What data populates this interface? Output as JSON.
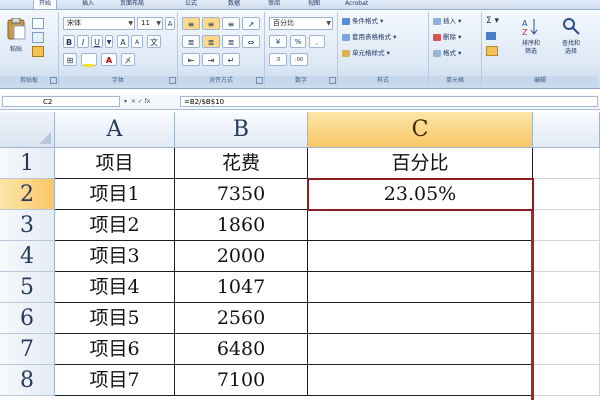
{
  "ribbon": {
    "tabs": [
      "开始",
      "插入",
      "页面布局",
      "公式",
      "数据",
      "审阅",
      "视图",
      "Acrobat"
    ],
    "groups": {
      "clipboard": "剪贴板",
      "font": "字体",
      "alignment": "对齐方式",
      "number": "数字",
      "styles": "样式",
      "cells": "单元格",
      "editing": "编辑"
    },
    "paste_label": "粘贴",
    "font_name": "宋体",
    "font_size": "11",
    "number_format": "百分比",
    "styles_items": [
      "条件格式",
      "套用表格格式",
      "单元格样式"
    ],
    "cells_items": [
      "插入",
      "删除",
      "格式"
    ],
    "editing_sort": "排序和\n筛选",
    "editing_find": "查找和\n选择"
  },
  "formula_bar": {
    "name_box": "C2",
    "formula": "=B2/$B$10"
  },
  "sheet": {
    "columns": [
      "A",
      "B",
      "C"
    ],
    "rows": [
      "1",
      "2",
      "3",
      "4",
      "5",
      "6",
      "7",
      "8"
    ],
    "cells": [
      [
        "项目",
        "花费",
        "百分比"
      ],
      [
        "项目1",
        "7350",
        "23.05%"
      ],
      [
        "项目2",
        "1860",
        ""
      ],
      [
        "项目3",
        "2000",
        ""
      ],
      [
        "项目4",
        "1047",
        ""
      ],
      [
        "项目5",
        "2560",
        ""
      ],
      [
        "项目6",
        "6480",
        ""
      ],
      [
        "项目7",
        "7100",
        ""
      ]
    ]
  },
  "colors": {
    "selected_header": "#f7c766",
    "selection_border": "#8b1e1e",
    "copy_marquee": "#b52020"
  }
}
